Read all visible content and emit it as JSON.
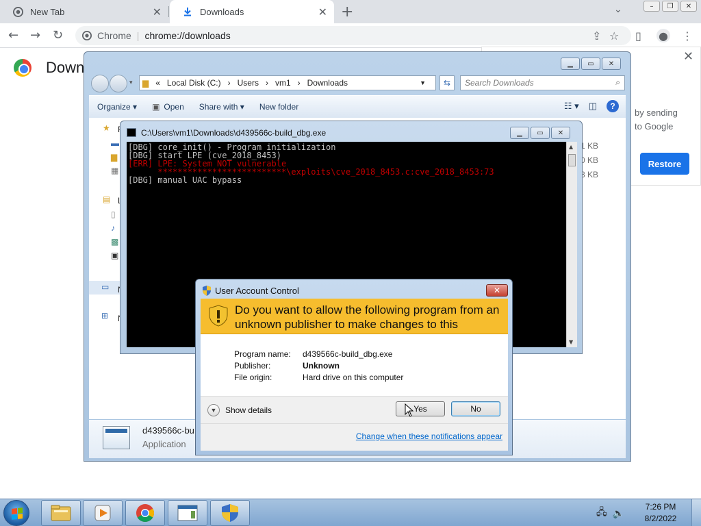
{
  "browser": {
    "tabs": [
      {
        "label": "New Tab",
        "icon": "chrome-icon"
      },
      {
        "label": "Downloads",
        "icon": "download-icon"
      }
    ],
    "url_site": "Chrome",
    "url_path": "chrome://downloads",
    "page_title": "Down",
    "banner": {
      "text_line1": "by sending",
      "text_line2": "to Google",
      "button": "Restore"
    }
  },
  "explorer": {
    "address": {
      "prefix": "«",
      "parts": [
        "Local Disk (C:)",
        "Users",
        "vm1",
        "Downloads"
      ]
    },
    "search_placeholder": "Search Downloads",
    "toolbar": {
      "organize": "Organize",
      "open": "Open",
      "share_with": "Share with",
      "new_folder": "New folder"
    },
    "sizes": [
      "1 KB",
      "0 KB",
      "8 KB"
    ],
    "nav_letters": [
      "F",
      "L",
      "N",
      "N"
    ],
    "details": {
      "name": "d439566c-bu",
      "type": "Application"
    }
  },
  "console": {
    "title": "C:\\Users\\vm1\\Downloads\\d439566c-build_dbg.exe",
    "lines": [
      {
        "text": "[DBG] core_init() - Program initialization",
        "err": false
      },
      {
        "text": "[DBG] start LPE (cve_2018_8453)",
        "err": false
      },
      {
        "text": "[ERR] LPE: System NOT vulnerable",
        "err": true
      },
      {
        "text": "      **************************\\exploits\\cve_2018_8453.c:cve_2018_8453:73",
        "err": true
      },
      {
        "text": "[DBG] manual UAC bypass",
        "err": false
      }
    ]
  },
  "uac": {
    "title": "User Account Control",
    "question": "Do you want to allow the following program from an unknown publisher to make changes to this computer?",
    "program_label": "Program name:",
    "program_value": "d439566c-build_dbg.exe",
    "publisher_label": "Publisher:",
    "publisher_value": "Unknown",
    "origin_label": "File origin:",
    "origin_value": "Hard drive on this computer",
    "show_details": "Show details",
    "yes": "Yes",
    "no": "No",
    "link": "Change when these notifications appear",
    "accent": "#f6bd2e"
  },
  "taskbar": {
    "time": "7:26 PM",
    "date": "8/2/2022"
  }
}
